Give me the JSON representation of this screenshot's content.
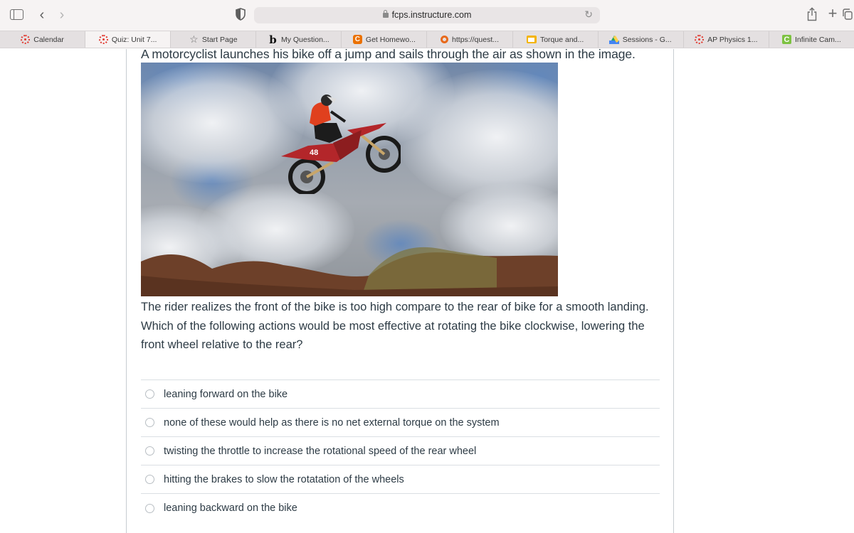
{
  "browser": {
    "url": "fcps.instructure.com",
    "icons": {
      "sidebar": "sidebar-icon",
      "back": "chevron-left-icon",
      "forward": "chevron-right-icon",
      "privacy": "shield-icon",
      "lock": "lock-icon",
      "reload": "reload-icon",
      "share": "share-icon",
      "new_tab": "plus-icon",
      "tab_overview": "tabs-overview-icon"
    }
  },
  "tabs": [
    {
      "label": "Calendar",
      "icon": "canvas-icon",
      "active": false
    },
    {
      "label": "Quiz: Unit 7...",
      "icon": "canvas-icon",
      "active": true
    },
    {
      "label": "Start Page",
      "icon": "star-icon",
      "active": false
    },
    {
      "label": "My Question...",
      "icon": "bartleby-icon",
      "active": false
    },
    {
      "label": "Get Homewo...",
      "icon": "chegg-icon",
      "active": false
    },
    {
      "label": "https://quest...",
      "icon": "quizlet-icon",
      "active": false
    },
    {
      "label": "Torque and...",
      "icon": "slides-icon",
      "active": false
    },
    {
      "label": "Sessions - G...",
      "icon": "google-drive-icon",
      "active": false
    },
    {
      "label": "AP Physics 1...",
      "icon": "canvas-icon",
      "active": false
    },
    {
      "label": "Infinite Cam...",
      "icon": "infinite-campus-icon",
      "active": false
    }
  ],
  "question": {
    "intro": "A motorcyclist launches his bike off a jump and sails through the air as shown in the image.",
    "image_alt": "Motocross rider mid-air on red dirt bike number 48 against cloudy sky above dirt mounds",
    "bike_number": "48",
    "body": "The rider realizes the front of the bike is too high compare to the rear of bike for a smooth landing. Which of the following actions would be most effective at rotating the bike clockwise, lowering the front wheel relative to the rear?",
    "answers": [
      {
        "label": "leaning forward on the bike",
        "selected": false
      },
      {
        "label": "none of these would help as there is no net external torque on the system",
        "selected": false
      },
      {
        "label": "twisting the throttle to increase the rotational speed of the rear wheel",
        "selected": false
      },
      {
        "label": "hitting the brakes to slow the rotatation of the wheels",
        "selected": false
      },
      {
        "label": "leaning backward on the bike",
        "selected": false
      }
    ]
  },
  "colors": {
    "canvas_red": "#e13c33",
    "text": "#2d3b45",
    "border": "#c7cdd1"
  }
}
